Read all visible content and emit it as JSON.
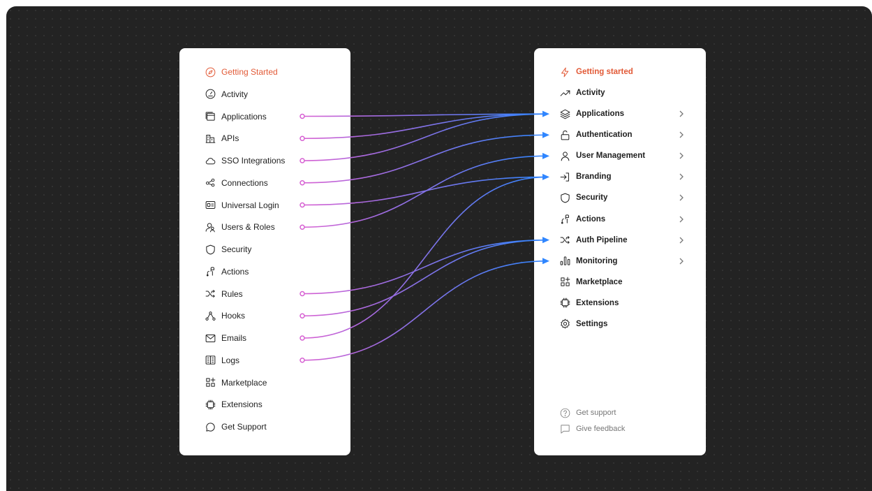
{
  "old_nav": {
    "items": [
      {
        "label": "Getting Started",
        "icon": "compass-icon",
        "active": true
      },
      {
        "label": "Activity",
        "icon": "gauge-icon"
      },
      {
        "label": "Applications",
        "icon": "windows-icon"
      },
      {
        "label": "APIs",
        "icon": "buildings-icon"
      },
      {
        "label": "SSO Integrations",
        "icon": "cloud-icon"
      },
      {
        "label": "Connections",
        "icon": "share-icon"
      },
      {
        "label": "Universal Login",
        "icon": "id-card-icon"
      },
      {
        "label": "Users & Roles",
        "icon": "users-icon"
      },
      {
        "label": "Security",
        "icon": "shield-icon"
      },
      {
        "label": "Actions",
        "icon": "actions-icon"
      },
      {
        "label": "Rules",
        "icon": "shuffle-icon"
      },
      {
        "label": "Hooks",
        "icon": "nodes-icon"
      },
      {
        "label": "Emails",
        "icon": "mail-icon"
      },
      {
        "label": "Logs",
        "icon": "book-icon"
      },
      {
        "label": "Marketplace",
        "icon": "grid-plus-icon"
      },
      {
        "label": "Extensions",
        "icon": "chip-icon"
      },
      {
        "label": "Get Support",
        "icon": "chat-bubble-icon"
      }
    ]
  },
  "new_nav": {
    "items": [
      {
        "label": "Getting started",
        "icon": "bolt-icon",
        "active": true,
        "chevron": false
      },
      {
        "label": "Activity",
        "icon": "trend-up-icon",
        "chevron": false
      },
      {
        "label": "Applications",
        "icon": "layers-icon",
        "chevron": true
      },
      {
        "label": "Authentication",
        "icon": "lock-icon",
        "chevron": true
      },
      {
        "label": "User Management",
        "icon": "user-icon",
        "chevron": true
      },
      {
        "label": "Branding",
        "icon": "sign-in-icon",
        "chevron": true
      },
      {
        "label": "Security",
        "icon": "shield-icon",
        "chevron": true
      },
      {
        "label": "Actions",
        "icon": "actions-icon",
        "chevron": true
      },
      {
        "label": "Auth Pipeline",
        "icon": "shuffle-icon",
        "chevron": true
      },
      {
        "label": "Monitoring",
        "icon": "bars-icon",
        "chevron": true
      },
      {
        "label": "Marketplace",
        "icon": "grid-plus-icon",
        "chevron": false
      },
      {
        "label": "Extensions",
        "icon": "chip-icon",
        "chevron": false
      },
      {
        "label": "Settings",
        "icon": "gear-icon",
        "chevron": false
      }
    ],
    "footer": [
      {
        "label": "Get support",
        "icon": "help-circle-icon"
      },
      {
        "label": "Give feedback",
        "icon": "message-square-icon"
      }
    ]
  },
  "mappings": [
    {
      "from": "Applications",
      "to": "Applications"
    },
    {
      "from": "APIs",
      "to": "Applications"
    },
    {
      "from": "SSO Integrations",
      "to": "Applications"
    },
    {
      "from": "Connections",
      "to": "Authentication"
    },
    {
      "from": "Universal Login",
      "to": "Branding"
    },
    {
      "from": "Users & Roles",
      "to": "User Management"
    },
    {
      "from": "Rules",
      "to": "Auth Pipeline"
    },
    {
      "from": "Hooks",
      "to": "Auth Pipeline"
    },
    {
      "from": "Emails",
      "to": "Branding"
    },
    {
      "from": "Logs",
      "to": "Monitoring"
    }
  ],
  "colors": {
    "accent": "#e25a37",
    "source": "#d65fd2",
    "target": "#2f86ff",
    "background": "#232323"
  }
}
